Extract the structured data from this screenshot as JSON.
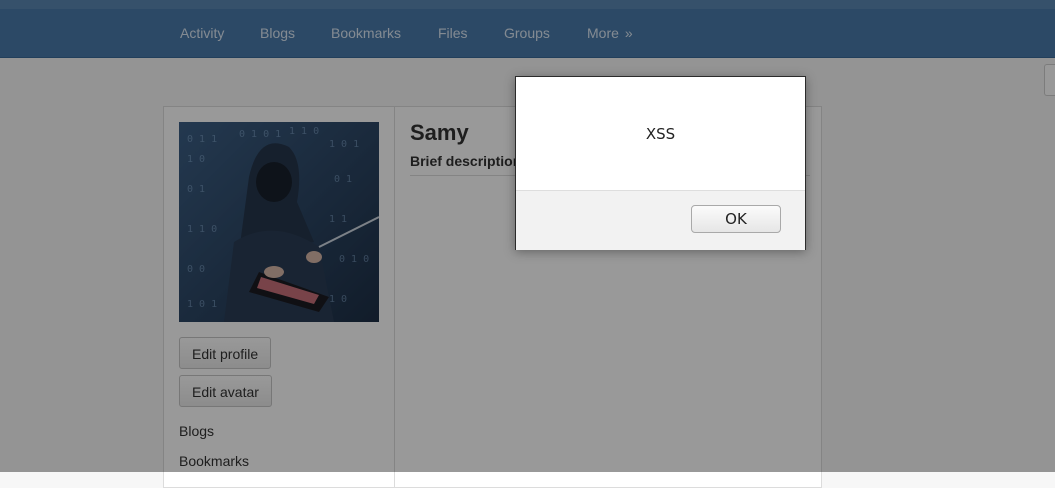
{
  "nav": {
    "items": [
      {
        "label": "Activity"
      },
      {
        "label": "Blogs"
      },
      {
        "label": "Bookmarks"
      },
      {
        "label": "Files"
      },
      {
        "label": "Groups"
      },
      {
        "label": "More",
        "chevron": "»"
      }
    ]
  },
  "profile": {
    "name": "Samy",
    "brief_description_label": "Brief description:",
    "edit_profile": "Edit profile",
    "edit_avatar": "Edit avatar",
    "links": [
      "Blogs",
      "Bookmarks"
    ]
  },
  "alert": {
    "message": "XSS",
    "ok_label": "OK"
  },
  "colors": {
    "nav_bg": "#4a7bab",
    "overlay": "rgba(0,0,0,0.40)"
  }
}
